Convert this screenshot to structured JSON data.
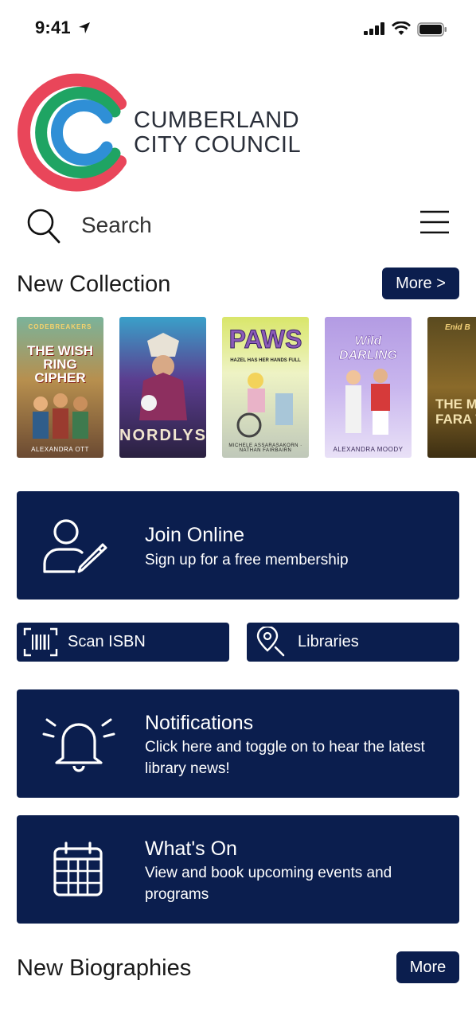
{
  "status": {
    "time": "9:41"
  },
  "brand": {
    "line1": "CUMBERLAND",
    "line2": "CITY COUNCIL",
    "colors": [
      "#e9465a",
      "#1fa463",
      "#2f8fd6"
    ]
  },
  "search": {
    "label": "Search"
  },
  "new_collection": {
    "title": "New Collection",
    "more_label": "More >",
    "books": [
      {
        "series": "CODEBREAKERS",
        "title": "The Wish Ring Cipher",
        "title_display": "THE WISH RING CIPHER",
        "author": "ALEXANDRA OTT"
      },
      {
        "title": "Nordlys",
        "title_display": "NORDLYS",
        "author": ""
      },
      {
        "title": "Paws",
        "title_display": "PAWS",
        "subtitle": "HAZEL HAS HER HANDS FULL",
        "author": "MICHELE ASSARASAKORN · NATHAN FAIRBAIRN"
      },
      {
        "title": "Wild Darling",
        "title_display": "Wild DARLING",
        "author": "ALEXANDRA MOODY"
      },
      {
        "author_top": "Enid B",
        "title_display": "THE MAG FARA TR",
        "author": ""
      }
    ]
  },
  "join": {
    "title": "Join Online",
    "subtitle": "Sign up for a free membership"
  },
  "scan": {
    "label": "Scan ISBN"
  },
  "libraries": {
    "label": "Libraries"
  },
  "notifications": {
    "title": "Notifications",
    "subtitle": "Click here and toggle on to hear the latest library news!"
  },
  "whats_on": {
    "title": "What's On",
    "subtitle": "View and book upcoming events and programs"
  },
  "new_biographies": {
    "title": "New Biographies",
    "more_label": "More"
  },
  "accent": "#0b1e4e"
}
